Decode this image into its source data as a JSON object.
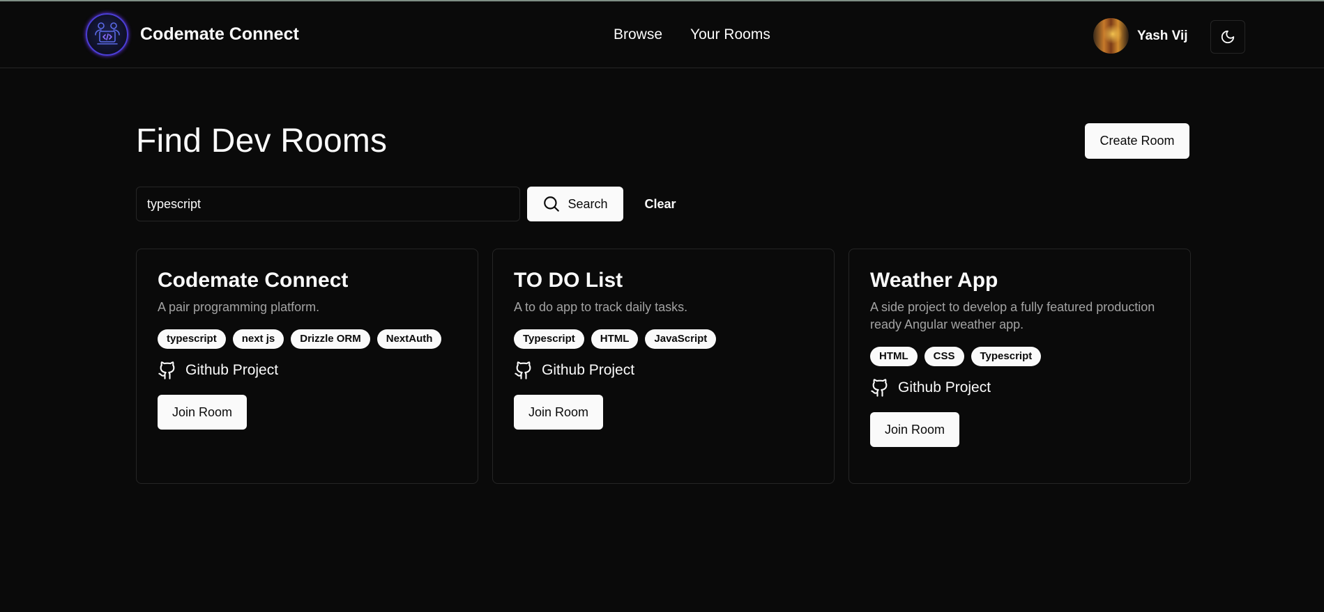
{
  "header": {
    "brand_name": "Codemate Connect",
    "logo_icon": "laptop-pair-icon",
    "nav": [
      {
        "label": "Browse"
      },
      {
        "label": "Your Rooms"
      }
    ],
    "user_name": "Yash Vij",
    "theme_icon": "moon-icon"
  },
  "page": {
    "title": "Find Dev Rooms",
    "create_label": "Create Room"
  },
  "search": {
    "value": "typescript",
    "button_label": "Search",
    "clear_label": "Clear"
  },
  "rooms": [
    {
      "name": "Codemate Connect",
      "description": "A pair programming platform.",
      "tags": [
        "typescript",
        "next js",
        "Drizzle ORM",
        "NextAuth"
      ],
      "github_label": "Github Project",
      "join_label": "Join Room"
    },
    {
      "name": "TO DO List",
      "description": "A to do app to track daily tasks.",
      "tags": [
        "Typescript",
        "HTML",
        "JavaScript"
      ],
      "github_label": "Github Project",
      "join_label": "Join Room"
    },
    {
      "name": "Weather App",
      "description": "A side project to develop a fully featured production ready Angular weather app.",
      "tags": [
        "HTML",
        "CSS",
        "Typescript"
      ],
      "github_label": "Github Project",
      "join_label": "Join Room"
    }
  ],
  "colors": {
    "background": "#0a0a0a",
    "foreground": "#fafafa",
    "muted": "#a3a3a3",
    "border": "#262626",
    "logo_accent": "#4b3fd6"
  }
}
